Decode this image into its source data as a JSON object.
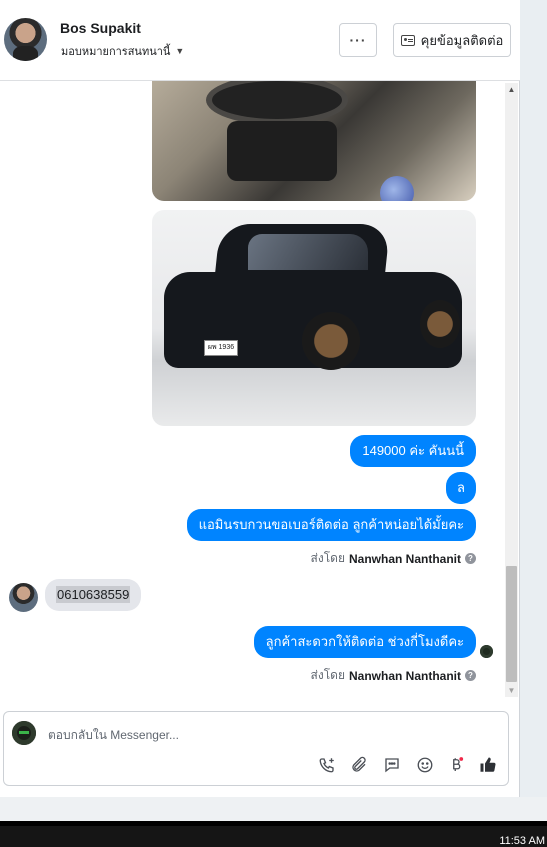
{
  "header": {
    "contact_name": "Bos Supakit",
    "assign_label": "มอบหมายการสนทนานี้",
    "more_label": "···",
    "contact_info_label": "คุยข้อมูลติดต่อ"
  },
  "messages": {
    "outgoing_1": "149000 ค่ะ คันนนี้",
    "outgoing_2": "ล",
    "outgoing_3": "แอมินรบกวนขอเบอร์ติดต่อ ลูกค้าหน่อยได้มั้ยคะ",
    "sent_by_1_prefix": "ส่งโดย",
    "sent_by_1_name": "Nanwhan Nanthanit",
    "incoming_1": "0610638559",
    "outgoing_4": "ลูกค้าสะดวกให้ติดต่อ ช่วงกี่โมงดีคะ",
    "sent_by_2_prefix": "ส่งโดย",
    "sent_by_2_name": "Nanwhan Nanthanit",
    "plate_text": "ผพ 1936"
  },
  "composer": {
    "placeholder": "ตอบกลับใน Messenger...",
    "tools": [
      "call-icon",
      "attach-icon",
      "saved-replies-icon",
      "emoji-icon",
      "payment-icon",
      "like-icon"
    ]
  },
  "taskbar": {
    "clock": "11:53 AM"
  },
  "colors": {
    "accent": "#0084ff",
    "incoming_bubble": "#e4e6eb"
  }
}
